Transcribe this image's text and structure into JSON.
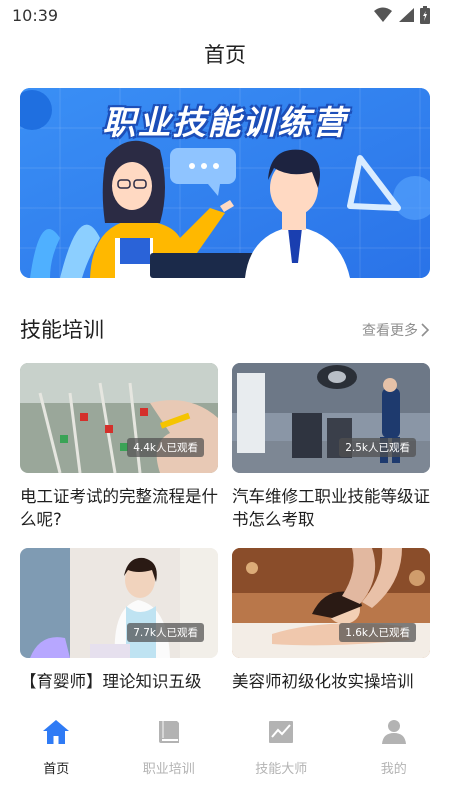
{
  "status_bar": {
    "time": "10:39"
  },
  "header": {
    "title": "首页"
  },
  "banner": {
    "title": "职业技能训练营"
  },
  "section": {
    "title": "技能培训",
    "more_label": "查看更多"
  },
  "cards": [
    {
      "title": "电工证考试的完整流程是什么呢?",
      "views": "4.4k人已观看"
    },
    {
      "title": "汽车维修工职业技能等级证书怎么考取",
      "views": "2.5k人已观看"
    },
    {
      "title": "【育婴师】理论知识五级",
      "views": "7.7k人已观看"
    },
    {
      "title": "美容师初级化妆实操培训",
      "views": "1.6k人已观看"
    }
  ],
  "bottom_nav": {
    "items": [
      {
        "label": "首页",
        "icon": "home-icon",
        "active": true
      },
      {
        "label": "职业培训",
        "icon": "book-icon",
        "active": false
      },
      {
        "label": "技能大师",
        "icon": "chart-icon",
        "active": false
      },
      {
        "label": "我的",
        "icon": "user-icon",
        "active": false
      }
    ]
  },
  "colors": {
    "accent": "#2f7bf5",
    "inactive": "#b3b3b3",
    "banner_bg": "#2f86f0"
  }
}
